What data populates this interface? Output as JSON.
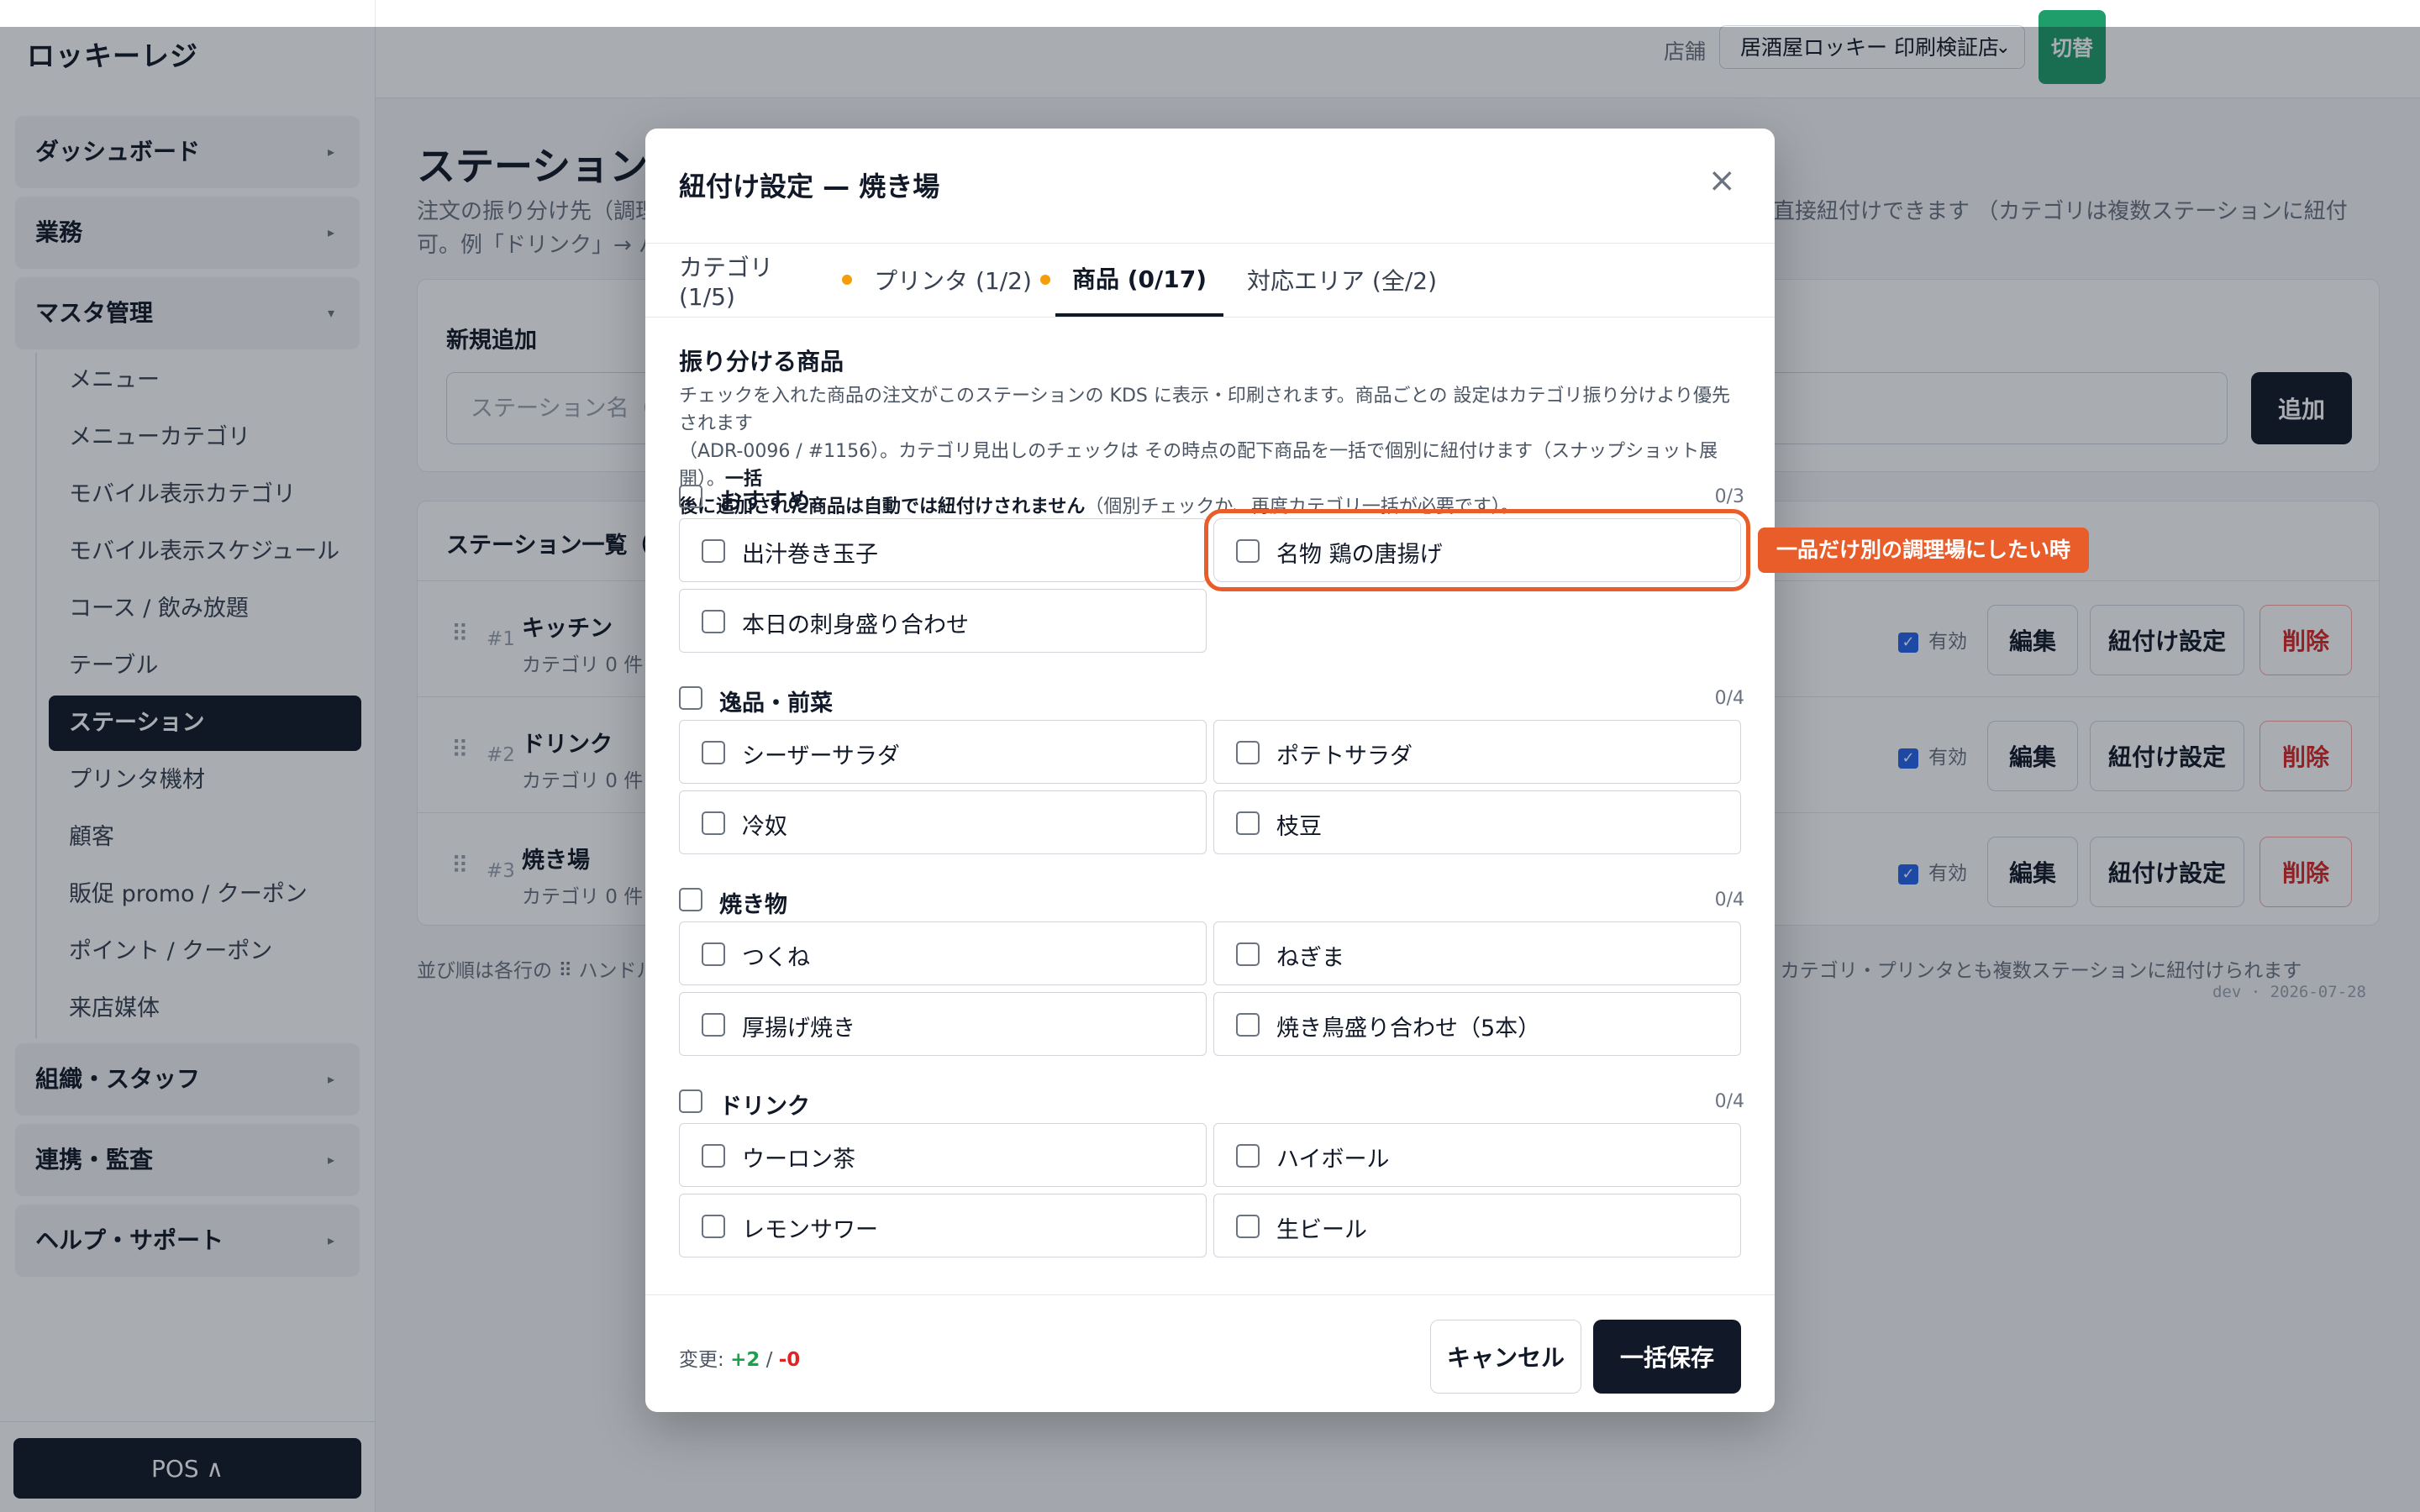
{
  "app": {
    "brand": "ロッキーレジ"
  },
  "header": {
    "store_label": "店舗",
    "store_selected": "居酒屋ロッキー 印刷検証店",
    "switch_label": "切替"
  },
  "sidebar": {
    "sections": [
      {
        "label": "ダッシュボード",
        "chevron": "▸"
      },
      {
        "label": "業務",
        "chevron": "▸"
      },
      {
        "label": "マスタ管理",
        "chevron": "▾"
      },
      {
        "label": "組織・スタッフ",
        "chevron": "▸"
      },
      {
        "label": "連携・監査",
        "chevron": "▸"
      },
      {
        "label": "ヘルプ・サポート",
        "chevron": "▸"
      }
    ],
    "items": [
      "メニュー",
      "メニューカテゴリ",
      "モバイル表示カテゴリ",
      "モバイル表示スケジュール",
      "コース / 飲み放題",
      "テーブル",
      "ステーション",
      "プリンタ機材",
      "顧客",
      "販促 promo / クーポン",
      "ポイント / クーポン",
      "来店媒体"
    ],
    "pos_button": "POS ∧"
  },
  "main": {
    "title": "ステーション",
    "desc_left": "注文の振り分け先（調理",
    "desc_right": "から直接紐付けできます （カテゴリは複数ステーションに紐付け",
    "desc_line2": "可。例「ドリンク」→ バー・",
    "new_card_title": "新規追加",
    "name_placeholder": "ステーション名（例:",
    "add_button": "追加",
    "list_title": "ステーション一覧（3 件",
    "stations": [
      {
        "num": "#1",
        "name": "キッチン",
        "sub": "カテゴリ 0 件・"
      },
      {
        "num": "#2",
        "name": "ドリンク",
        "sub": "カテゴリ 0 件・"
      },
      {
        "num": "#3",
        "name": "焼き場",
        "sub": "カテゴリ 0 件・"
      }
    ],
    "enabled_label": "有効",
    "edit_button": "編集",
    "link_button": "紐付け設定",
    "delete_button": "削除",
    "note_left": "並び順は各行の ⠿ ハンドルを",
    "note_right": "できます。カテゴリ・プリンタとも複数ステーションに紐付けられます（M:N）。",
    "version": "dev · 2026-07-28"
  },
  "modal": {
    "title": "紐付け設定 — 焼き場",
    "close_icon": "×",
    "tabs": [
      {
        "label": "カテゴリ (1/5)",
        "dot": true
      },
      {
        "label": "プリンタ (1/2)",
        "dot": true
      },
      {
        "label": "商品 (0/17)",
        "dot": false,
        "active": true
      },
      {
        "label": "対応エリア (全/2)",
        "dot": false
      }
    ],
    "section_title": "振り分ける商品",
    "desc_1": "チェックを入れた商品の注文がこのステーションの KDS に表示・印刷されます。商品ごとの 設定はカテゴリ振り分けより優先されます",
    "desc_2a": "（ADR-0096 / #1156）。カテゴリ見出しのチェックは その時点の配下商品を一括で個別に紐付けます（スナップショット展開）。",
    "desc_2b": "一括",
    "desc_3a": "後に追加された商品は自動では紐付けされません",
    "desc_3b": "（個別チェックか、再度カテゴリ一括が必要です）。",
    "groups": [
      {
        "name": "おすすめ",
        "count": "0/3",
        "items": [
          "出汁巻き玉子",
          "名物 鶏の唐揚げ",
          "本日の刺身盛り合わせ"
        ]
      },
      {
        "name": "逸品・前菜",
        "count": "0/4",
        "items": [
          "シーザーサラダ",
          "ポテトサラダ",
          "冷奴",
          "枝豆"
        ]
      },
      {
        "name": "焼き物",
        "count": "0/4",
        "items": [
          "つくね",
          "ねぎま",
          "厚揚げ焼き",
          "焼き鳥盛り合わせ（5本）"
        ]
      },
      {
        "name": "ドリンク",
        "count": "0/4",
        "items": [
          "ウーロン茶",
          "ハイボール",
          "レモンサワー",
          "生ビール"
        ]
      }
    ],
    "change_label": "変更:",
    "change_plus": "+2",
    "change_sep": "/",
    "change_minus": "-0",
    "cancel_button": "キャンセル",
    "save_button": "一括保存",
    "callout": "一品だけ別の調理場にしたい時"
  },
  "colors": {
    "accent": "#111827",
    "callout": "#e85d2a",
    "switch": "#1f9d6a",
    "danger": "#dc2626",
    "dot": "#f59e0b"
  }
}
